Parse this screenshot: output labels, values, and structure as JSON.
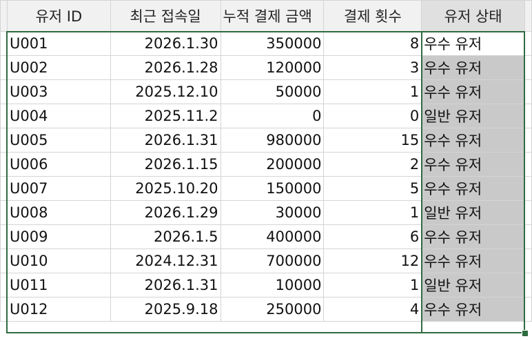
{
  "headers": [
    "유저 ID",
    "최근 접속일",
    "누적 결제 금액",
    "결제 횟수",
    "유저 상태"
  ],
  "rows": [
    [
      "U001",
      "2026.1.30",
      "350000",
      "8",
      "우수 유저"
    ],
    [
      "U002",
      "2026.1.28",
      "120000",
      "3",
      "우수 유저"
    ],
    [
      "U003",
      "2025.12.10",
      "50000",
      "1",
      "우수 유저"
    ],
    [
      "U004",
      "2025.11.2",
      "0",
      "0",
      "일반 유저"
    ],
    [
      "U005",
      "2026.1.31",
      "980000",
      "15",
      "우수 유저"
    ],
    [
      "U006",
      "2026.1.15",
      "200000",
      "2",
      "우수 유저"
    ],
    [
      "U007",
      "2025.10.20",
      "150000",
      "5",
      "우수 유저"
    ],
    [
      "U008",
      "2026.1.29",
      "30000",
      "1",
      "일반 유저"
    ],
    [
      "U009",
      "2026.1.5",
      "400000",
      "6",
      "우수 유저"
    ],
    [
      "U010",
      "2024.12.31",
      "700000",
      "12",
      "우수 유저"
    ],
    [
      "U011",
      "2026.1.31",
      "10000",
      "1",
      "일반 유저"
    ],
    [
      "U012",
      "2025.9.18",
      "250000",
      "4",
      "우수 유저"
    ]
  ],
  "colors": {
    "selection_border": "#2e6b3f",
    "selected_fill": "#c9c9c9",
    "header_fill": "#f1f1f1"
  }
}
